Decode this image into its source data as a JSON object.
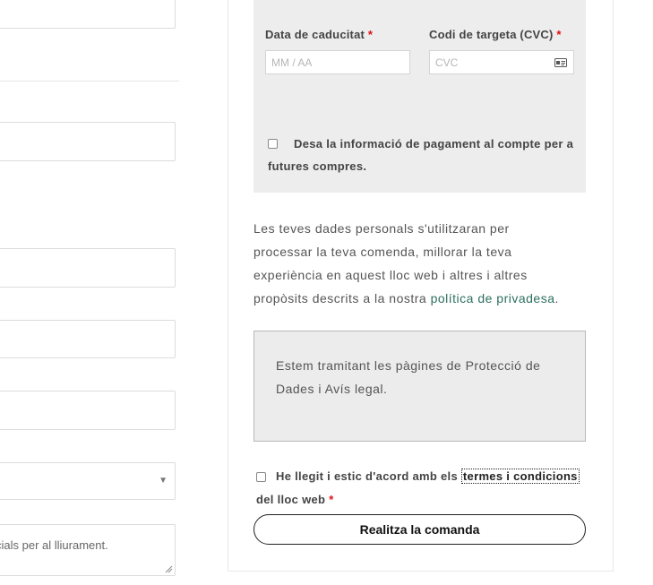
{
  "left_form": {
    "textarea_placeholder_visible": "cials per al lliurament."
  },
  "payment": {
    "expiry_label": "Data de caducitat",
    "expiry_placeholder": "MM / AA",
    "cvc_label": "Codi de targeta (CVC)",
    "cvc_placeholder": "CVC",
    "required_mark": "*",
    "save_info_label_line1": "Desa la informació de pagament al compte per a",
    "save_info_label_line2": "futures compres."
  },
  "privacy": {
    "line1": "Les teves dades personals s'utilitzaran per",
    "line2": "processar la teva comenda, millorar la teva",
    "line3": "experiència en aquest lloc web i altres i altres",
    "line4_prefix": "propòsits descrits a la nostra ",
    "link_text": "política de privadesa",
    "line4_suffix": "."
  },
  "notice": {
    "line1": "Estem tramitant les pàgines de Protecció de",
    "line2": "Dades i Avís legal."
  },
  "terms": {
    "prefix": "He llegit i estic d'acord amb els ",
    "link_text": "termes i condicions",
    "line2": "del lloc web",
    "required_mark": "*"
  },
  "place_order_label": "Realitza la comanda",
  "colors": {
    "required": "#dd1111",
    "link": "#2d6f5f",
    "payment_bg": "#ededed"
  }
}
